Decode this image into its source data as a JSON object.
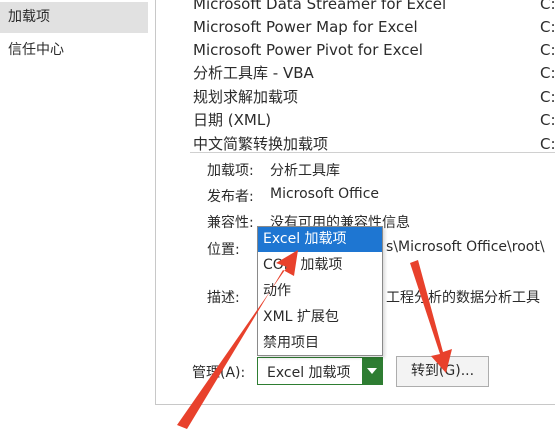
{
  "nav": {
    "items": [
      {
        "label": "加载项"
      },
      {
        "label": "信任中心"
      }
    ]
  },
  "addins": [
    {
      "name": "Microsoft Data Streamer for Excel",
      "location": "C:"
    },
    {
      "name": "Microsoft Power Map for Excel",
      "location": "C:"
    },
    {
      "name": "Microsoft Power Pivot for Excel",
      "location": "C:"
    },
    {
      "name": "分析工具库 - VBA",
      "location": "C:"
    },
    {
      "name": "规划求解加载项",
      "location": "C:"
    },
    {
      "name": "日期 (XML)",
      "location": "C:"
    },
    {
      "name": "中文简繁转换加载项",
      "location": "C:"
    }
  ],
  "details": {
    "addin_label": "加载项:",
    "addin_value": "分析工具库",
    "publisher_label": "发布者:",
    "publisher_value": "Microsoft Office",
    "compat_label": "兼容性:",
    "compat_value": "没有可用的兼容性信息",
    "location_label": "位置:",
    "location_value": "s\\Microsoft Office\\root\\",
    "desc_label": "描述:",
    "desc_value": "工程分析的数据分析工具"
  },
  "manage": {
    "label": "管理(A):",
    "selected": "Excel 加载项",
    "go_label": "转到(G)...",
    "options": [
      "Excel 加载项",
      "COM 加载项",
      "动作",
      "XML 扩展包",
      "禁用项目"
    ],
    "highlighted_index": 0
  },
  "colors": {
    "accent_green": "#2e7d32",
    "highlight_blue": "#1e76d2",
    "arrow_red": "#e8412c"
  }
}
